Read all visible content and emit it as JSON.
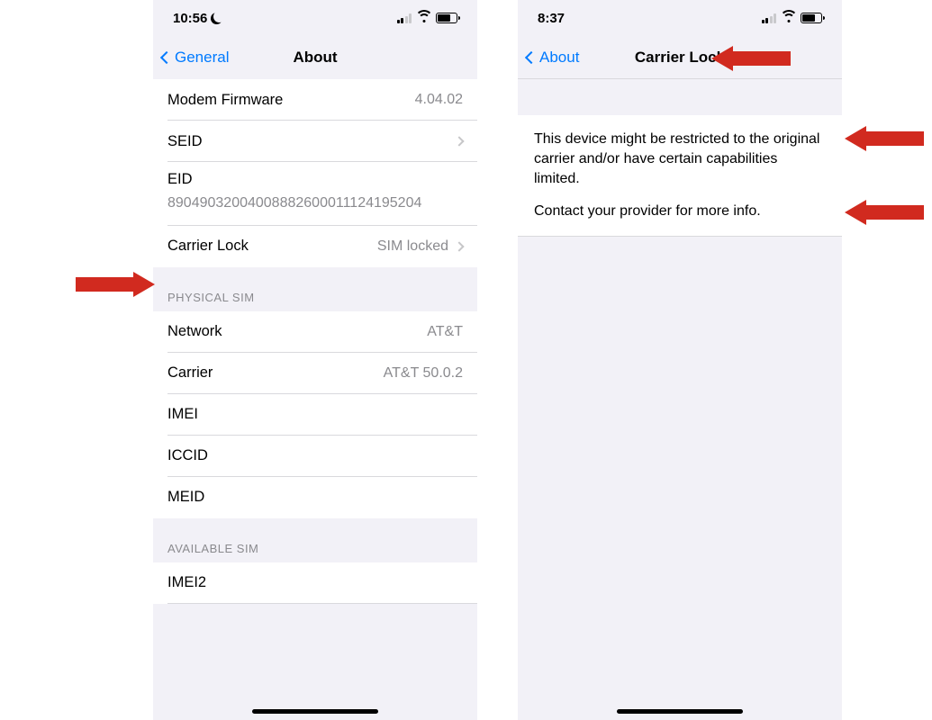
{
  "left": {
    "status": {
      "time": "10:56"
    },
    "nav": {
      "back": "General",
      "title": "About"
    },
    "rows": {
      "modem_firmware": {
        "label": "Modem Firmware",
        "value": "4.04.02"
      },
      "seid": {
        "label": "SEID",
        "value": ""
      },
      "eid": {
        "label": "EID",
        "value": "89049032004008882600011124195204"
      },
      "carrier_lock": {
        "label": "Carrier Lock",
        "value": "SIM locked"
      }
    },
    "section_physical": "Physical SIM",
    "physical": {
      "network": {
        "label": "Network",
        "value": "AT&T"
      },
      "carrier": {
        "label": "Carrier",
        "value": "AT&T 50.0.2"
      },
      "imei": {
        "label": "IMEI",
        "value": ""
      },
      "iccid": {
        "label": "ICCID",
        "value": ""
      },
      "meid": {
        "label": "MEID",
        "value": ""
      }
    },
    "section_available": "Available SIM",
    "available": {
      "imei2": {
        "label": "IMEI2",
        "value": ""
      }
    }
  },
  "right": {
    "status": {
      "time": "8:37"
    },
    "nav": {
      "back": "About",
      "title": "Carrier Lock"
    },
    "info": {
      "p1": "This device might be restricted to the original carrier and/or have certain capabilities limited.",
      "p2": "Contact your provider for more info."
    }
  }
}
